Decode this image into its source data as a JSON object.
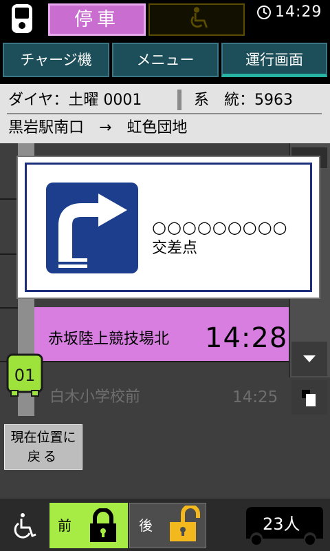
{
  "status": {
    "stop_label": "停車",
    "time": "14:29",
    "icons": {
      "bus": "bus-front-icon",
      "wheelchair": "wheelchair-icon",
      "clock": "clock-icon"
    }
  },
  "tabs": [
    {
      "label": "チャージ機"
    },
    {
      "label": "メニュー"
    },
    {
      "label": "運行画面"
    }
  ],
  "info": {
    "diagram": "ダイヤ：土曜 0001",
    "system": "系　統：5963",
    "route": "黒岩駅南口　→　虹色団地"
  },
  "popup": {
    "icon": "turn-right-sign-icon",
    "line1": "○○○○○○○○○",
    "line2": "交差点"
  },
  "stops": [
    {
      "name": "赤坂陸上競技場北",
      "time": "14:28",
      "state": "current"
    },
    {
      "name": "白木小学校前",
      "time": "14:25",
      "state": "next"
    }
  ],
  "bus_marker": {
    "label": "01"
  },
  "buttons": {
    "current_position": [
      "現在位置に",
      "戻る"
    ],
    "front_door": "前",
    "rear_door": "後"
  },
  "passengers": "23人",
  "colors": {
    "stop_badge": "#c96ed0",
    "current_stop": "#d77ee0",
    "front_door_active": "#a6ec44",
    "lock_yellow": "#f2b81d",
    "tab": "#1d4f5a",
    "active_tab_underline": "#27b4a2",
    "sign_blue": "#1d3e8c"
  }
}
